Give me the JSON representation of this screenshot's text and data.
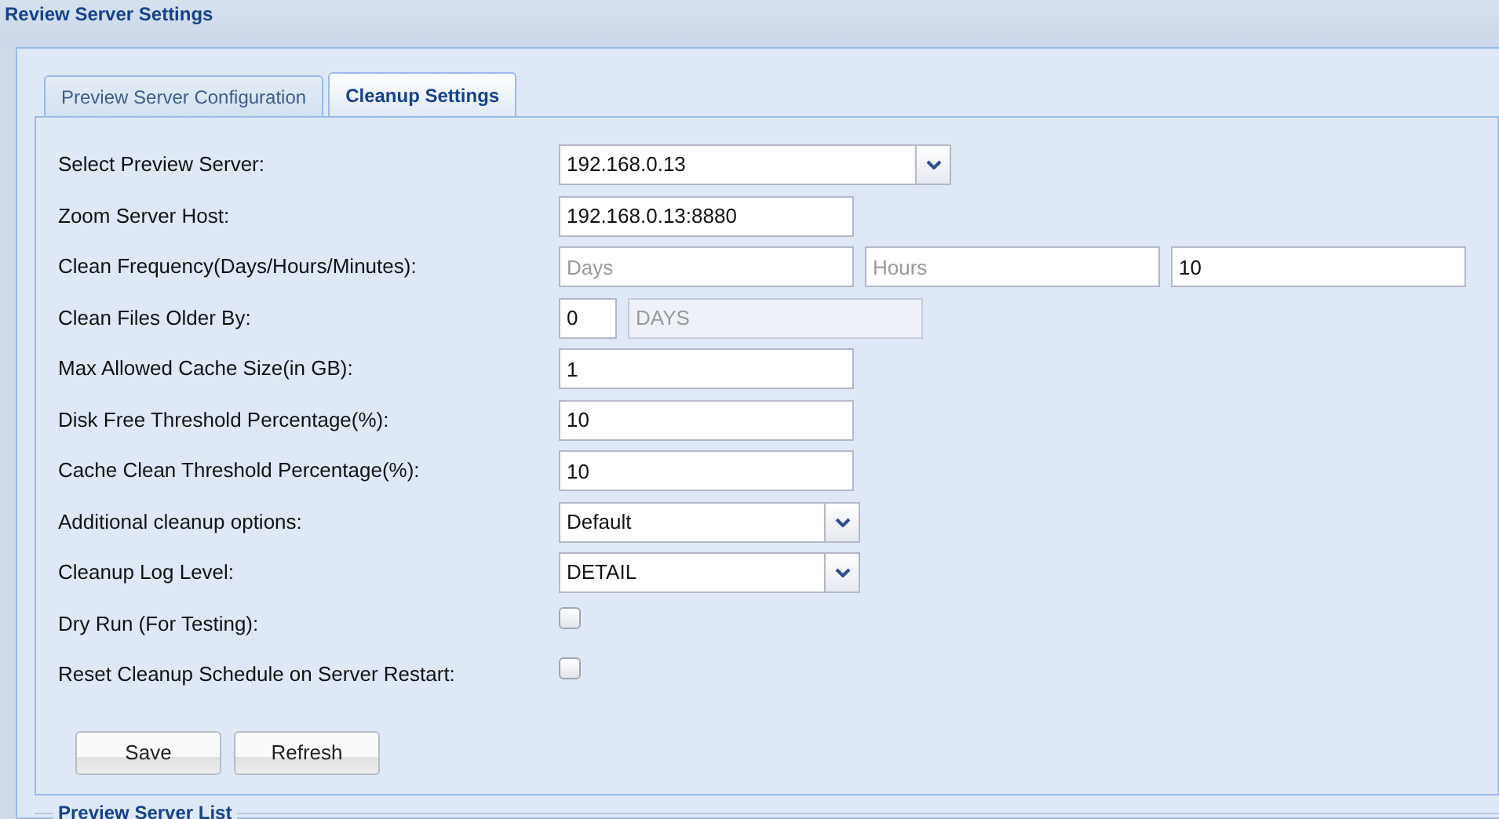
{
  "header": {
    "title": "Review Server Settings"
  },
  "tabs": [
    {
      "label": "Preview Server Configuration",
      "selected": false
    },
    {
      "label": "Cleanup Settings",
      "selected": true
    }
  ],
  "rows": [
    {
      "label": "Select Preview Server:",
      "kind": "select",
      "value": "192.168.0.13"
    },
    {
      "label": "Zoom Server Host:",
      "kind": "text",
      "fields": [
        {
          "value": "192.168.0.13:8880"
        }
      ]
    },
    {
      "label": "Clean Frequency(Days/Hours/Minutes):",
      "kind": "text",
      "fields": [
        {
          "placeholder": "Days"
        },
        {
          "placeholder": "Hours"
        },
        {
          "value": "10"
        }
      ]
    },
    {
      "label": "Clean Files Older By:",
      "kind": "text",
      "fields": [
        {
          "value": "0"
        },
        {
          "value": "DAYS",
          "disabled": true
        }
      ]
    },
    {
      "label": "Max Allowed Cache Size(in GB):",
      "kind": "text",
      "fields": [
        {
          "value": "1"
        }
      ]
    },
    {
      "label": "Disk Free Threshold Percentage(%):",
      "kind": "text",
      "fields": [
        {
          "value": "10"
        }
      ]
    },
    {
      "label": "Cache Clean Threshold Percentage(%):",
      "kind": "text",
      "fields": [
        {
          "value": "10"
        }
      ]
    },
    {
      "label": "Additional cleanup options:",
      "kind": "select",
      "value": "Default"
    },
    {
      "label": "Cleanup Log Level:",
      "kind": "select",
      "value": "DETAIL"
    },
    {
      "label": "Dry Run (For Testing):",
      "kind": "checkbox",
      "checked": false
    },
    {
      "label": "Reset Cleanup Schedule on Server Restart:",
      "kind": "checkbox",
      "checked": false
    }
  ],
  "buttons": [
    "Save",
    "Refresh"
  ],
  "server_list": {
    "legend": "Preview Server List"
  }
}
